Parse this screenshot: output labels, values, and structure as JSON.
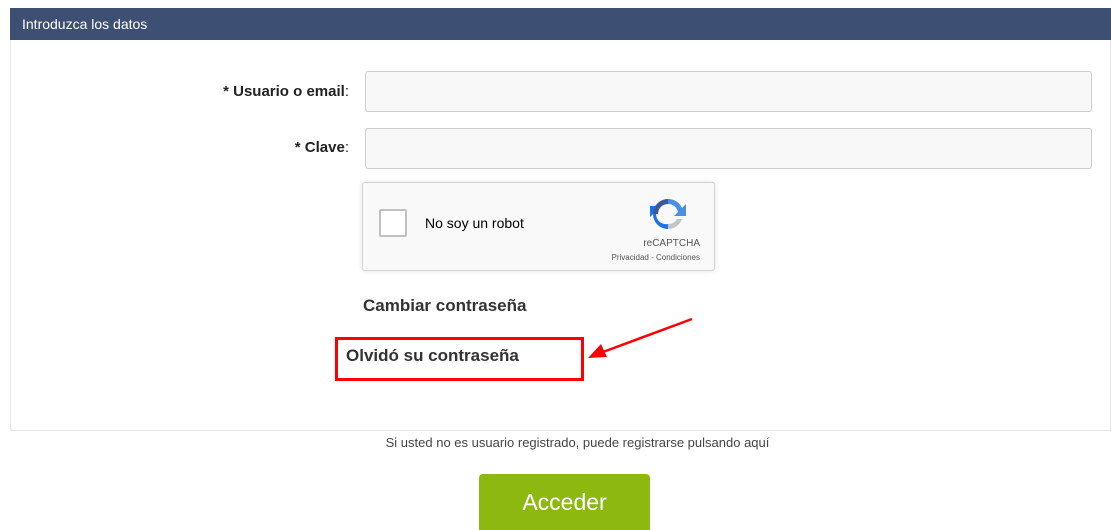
{
  "header": {
    "title": "Introduzca los datos"
  },
  "form": {
    "user_label": "* Usuario o email",
    "user_value": "",
    "password_label": "* Clave",
    "password_value": "",
    "colon": ":"
  },
  "captcha": {
    "checkbox_label": "No soy un robot",
    "brand": "reCAPTCHA",
    "links": "Privacidad - Condiciones",
    "icon": "recaptcha-logo",
    "checked": false
  },
  "links": {
    "change_password": "Cambiar contraseña",
    "forgot_password": "Olvidó su contraseña"
  },
  "register_note": "Si usted no es usuario registrado, puede registrarse pulsando aquí",
  "submit_label": "Acceder",
  "colors": {
    "header_bg": "#3d4f72",
    "button_bg": "#8cb80f",
    "highlight": "#ff0000"
  }
}
